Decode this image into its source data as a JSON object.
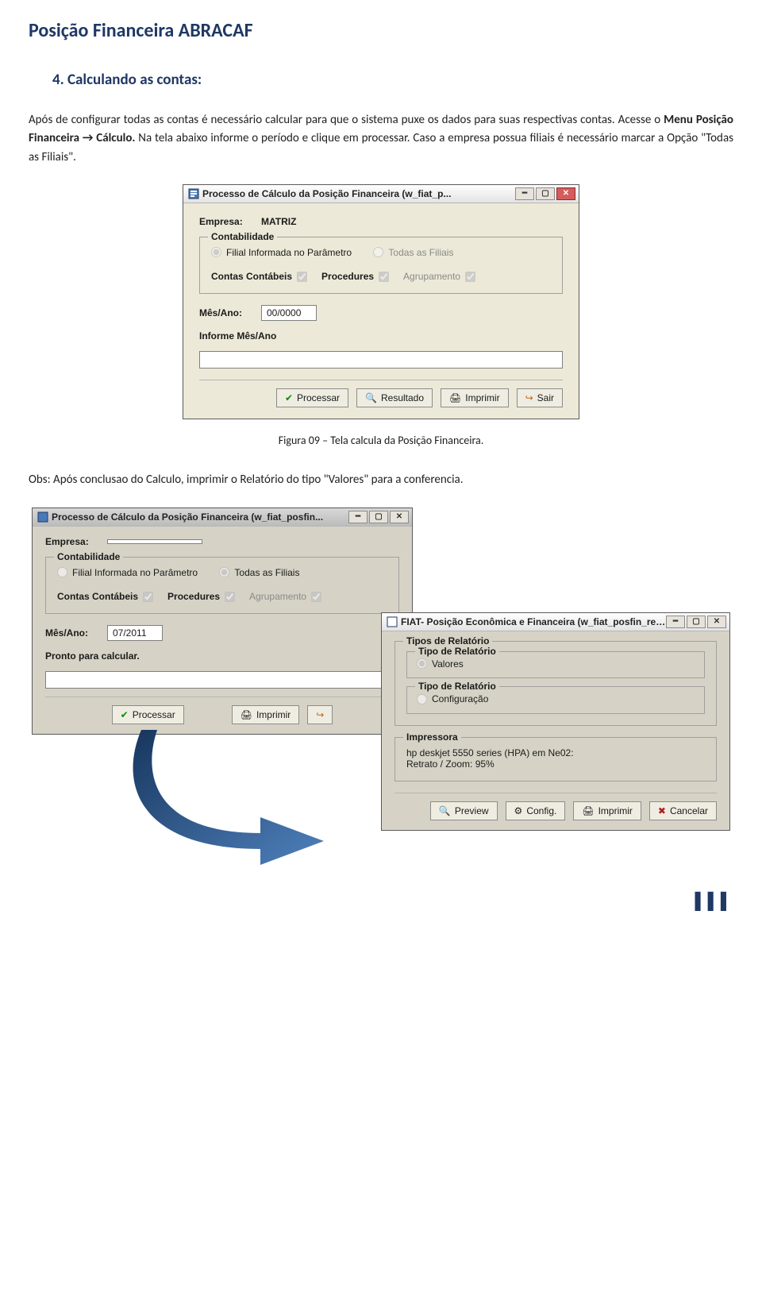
{
  "doc": {
    "title": "Posição Financeira ABRACAF",
    "section_title": "4. Calculando as contas:",
    "paragraph_1_pre": "Após de configurar todas as contas é necessário calcular para que o sistema puxe os dados para suas respectivas contas. Acesse o ",
    "paragraph_1_bold": "Menu Posição Financeira → Cálculo.",
    "paragraph_1_post": " Na tela abaixo informe o período e clique em processar. Caso a empresa possua filiais é necessário marcar a Opção \"Todas as Filiais\".",
    "caption_fig9": "Figura 09 – Tela calcula da Posição Financeira.",
    "paragraph_2": "Obs: Após conclusao do Calculo, imprimir o Relatório do tipo \"Valores\" para a conferencia."
  },
  "dlg1": {
    "title": "Processo de Cálculo da Posição Financeira (w_fiat_p...",
    "empresa_label": "Empresa:",
    "empresa_value": "MATRIZ",
    "group_legend": "Contabilidade",
    "radio_filial": "Filial Informada no Parâmetro",
    "radio_todas": "Todas as Filiais",
    "chk_contas": "Contas Contábeis",
    "chk_proc": "Procedures",
    "chk_agrup": "Agrupamento",
    "mesano_label": "Mês/Ano:",
    "mesano_value": "00/0000",
    "informe_label": "Informe Mês/Ano",
    "btn_processar": "Processar",
    "btn_resultado": "Resultado",
    "btn_imprimir": "Imprimir",
    "btn_sair": "Sair"
  },
  "dlg2": {
    "title": "Processo de Cálculo da Posição Financeira (w_fiat_posfin...",
    "empresa_label": "Empresa:",
    "empresa_value": "",
    "group_legend": "Contabilidade",
    "radio_filial": "Filial Informada no Parâmetro",
    "radio_todas": "Todas as Filiais",
    "chk_contas": "Contas Contábeis",
    "chk_proc": "Procedures",
    "chk_agrup": "Agrupamento",
    "mesano_label": "Mês/Ano:",
    "mesano_value": "07/2011",
    "status": "Pronto para calcular.",
    "btn_processar": "Processar",
    "btn_imprimir": "Imprimir"
  },
  "dlg3": {
    "title": "FIAT- Posição Econômica e Financeira (w_fiat_posfin_relator...",
    "group1_legend": "Tipos de Relatório",
    "group1a_legend": "Tipo de Relatório",
    "radio_valores": "Valores",
    "group1b_legend": "Tipo de Relatório",
    "radio_config": "Configuração",
    "group2_legend": "Impressora",
    "printer_name": "hp deskjet 5550 series (HPA) em Ne02:",
    "printer_zoom": "Retrato / Zoom: 95%",
    "btn_preview": "Preview",
    "btn_config": "Config.",
    "btn_imprimir": "Imprimir",
    "btn_cancelar": "Cancelar"
  }
}
